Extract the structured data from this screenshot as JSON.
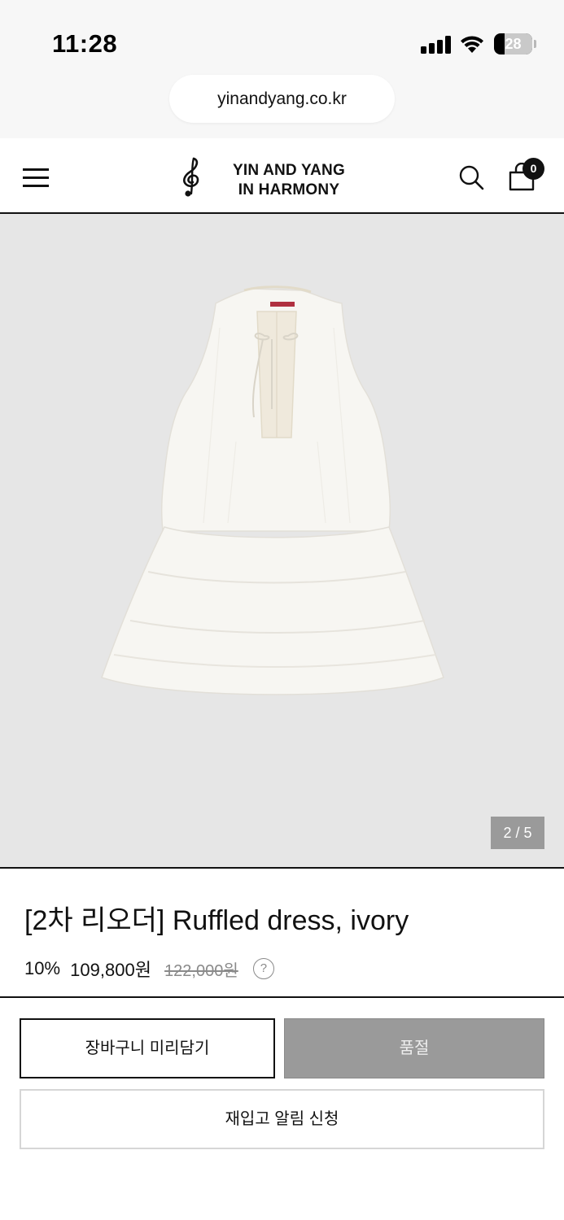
{
  "status_bar": {
    "time": "11:28",
    "battery": "28",
    "battery_level": 0.28,
    "icons": [
      "cellular-signal-icon",
      "wifi-icon",
      "battery-icon"
    ]
  },
  "browser": {
    "url": "yinandyang.co.kr"
  },
  "header": {
    "logo_line1": "YIN AND YANG",
    "logo_line2": "IN HARMONY",
    "cart_count": "0",
    "icons": [
      "hamburger-menu-icon",
      "treble-clef-logo-icon",
      "search-icon",
      "shopping-bag-icon"
    ]
  },
  "gallery": {
    "counter": "2 / 5",
    "background_color": "#e6e6e6"
  },
  "product": {
    "title": "[2차 리오더] Ruffled dress, ivory",
    "discount": "10%",
    "sale_price": "109,800원",
    "original_price": "122,000원",
    "help_icon": "?"
  },
  "actions": {
    "add_to_cart": "장바구니 미리담기",
    "sold_out": "품절",
    "restock_alert": "재입고 알림 신청"
  },
  "colors": {
    "text": "#111111",
    "sold_out_button": "#9a9a9a",
    "muted": "#8a8a8a"
  }
}
